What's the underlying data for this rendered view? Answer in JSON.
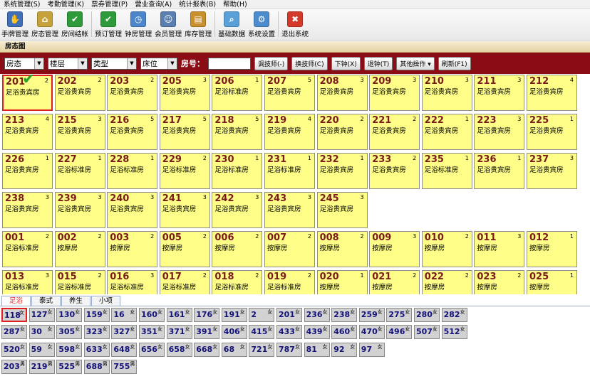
{
  "menubar": [
    "系统管理(S)",
    "考勤管理(K)",
    "票券管理(P)",
    "营业查询(A)",
    "统计报表(B)",
    "帮助(H)"
  ],
  "toolbar": [
    {
      "label": "手牌管理",
      "icon": "hand-card-icon",
      "color": "#3f6fb8"
    },
    {
      "label": "房态管理",
      "icon": "room-status-icon",
      "color": "#c6a23a"
    },
    {
      "label": "房间结帐",
      "icon": "checkout-check-icon",
      "color": "#2f9a3a"
    },
    {
      "label": "预订管理",
      "icon": "booking-check-icon",
      "color": "#2f9a3a"
    },
    {
      "label": "钟房管理",
      "icon": "clock-room-icon",
      "color": "#4a86c9"
    },
    {
      "label": "会员管理",
      "icon": "member-icon",
      "color": "#5a7fb0"
    },
    {
      "label": "库存管理",
      "icon": "inventory-icon",
      "color": "#c8902c"
    },
    {
      "label": "基础数据",
      "icon": "base-data-icon",
      "color": "#5aa0d8"
    },
    {
      "label": "系统设置",
      "icon": "system-settings-icon",
      "color": "#4c8ccc"
    },
    {
      "label": "退出系统",
      "icon": "exit-icon",
      "color": "#d43a2a"
    }
  ],
  "panel_title": "房态图",
  "filters": {
    "selects": [
      "房态",
      "楼层",
      "类型",
      "床位"
    ],
    "room_no_label": "房号：",
    "room_no_value": "",
    "buttons": [
      "调技师(-)",
      "换技师(C)",
      "下钟(X)",
      "退钟(T)",
      "其他操作 ▾",
      "刷新(F1)"
    ]
  },
  "rooms": [
    [
      {
        "no": "201",
        "type": "足浴贵宾房",
        "count": "2",
        "selected": true,
        "checked": true
      },
      {
        "no": "202",
        "type": "足浴贵宾房",
        "count": "2"
      },
      {
        "no": "203",
        "type": "足浴贵宾房",
        "count": "2"
      },
      {
        "no": "205",
        "type": "足浴贵宾房",
        "count": "3"
      },
      {
        "no": "206",
        "type": "足浴标准房",
        "count": "1"
      },
      {
        "no": "207",
        "type": "足浴贵宾房",
        "count": "5"
      },
      {
        "no": "208",
        "type": "足浴贵宾房",
        "count": "3"
      },
      {
        "no": "209",
        "type": "足浴贵宾房",
        "count": "3"
      },
      {
        "no": "210",
        "type": "足浴贵宾房",
        "count": "3"
      },
      {
        "no": "211",
        "type": "足浴贵宾房",
        "count": "3"
      },
      {
        "no": "212",
        "type": "足浴贵宾房",
        "count": "4"
      }
    ],
    [
      {
        "no": "213",
        "type": "足浴贵宾房",
        "count": "4"
      },
      {
        "no": "215",
        "type": "足浴贵宾房",
        "count": "3"
      },
      {
        "no": "216",
        "type": "足浴贵宾房",
        "count": "5"
      },
      {
        "no": "217",
        "type": "足浴贵宾房",
        "count": "5"
      },
      {
        "no": "218",
        "type": "足浴贵宾房",
        "count": "5"
      },
      {
        "no": "219",
        "type": "足浴贵宾房",
        "count": "4"
      },
      {
        "no": "220",
        "type": "足浴贵宾房",
        "count": "2"
      },
      {
        "no": "221",
        "type": "足浴贵宾房",
        "count": "2"
      },
      {
        "no": "222",
        "type": "足浴贵宾房",
        "count": "1"
      },
      {
        "no": "223",
        "type": "足浴贵宾房",
        "count": "3"
      },
      {
        "no": "225",
        "type": "足浴贵宾房",
        "count": "1"
      }
    ],
    [
      {
        "no": "226",
        "type": "足浴贵宾房",
        "count": "1"
      },
      {
        "no": "227",
        "type": "足浴标准房",
        "count": "1"
      },
      {
        "no": "228",
        "type": "足浴标准房",
        "count": "1"
      },
      {
        "no": "229",
        "type": "足浴标准房",
        "count": "2"
      },
      {
        "no": "230",
        "type": "足浴标准房",
        "count": "1"
      },
      {
        "no": "231",
        "type": "足浴标准房",
        "count": "1"
      },
      {
        "no": "232",
        "type": "足浴贵宾房",
        "count": "1"
      },
      {
        "no": "233",
        "type": "足浴贵宾房",
        "count": "2"
      },
      {
        "no": "235",
        "type": "足浴标准房",
        "count": "1"
      },
      {
        "no": "236",
        "type": "足浴贵宾房",
        "count": "1"
      },
      {
        "no": "237",
        "type": "足浴贵宾房",
        "count": "3"
      }
    ],
    [
      {
        "no": "238",
        "type": "足浴贵宾房",
        "count": "3"
      },
      {
        "no": "239",
        "type": "足浴贵宾房",
        "count": "3"
      },
      {
        "no": "240",
        "type": "足浴贵宾房",
        "count": "3"
      },
      {
        "no": "241",
        "type": "足浴贵宾房",
        "count": "3"
      },
      {
        "no": "242",
        "type": "足浴贵宾房",
        "count": "3"
      },
      {
        "no": "243",
        "type": "足浴贵宾房",
        "count": "3"
      },
      {
        "no": "245",
        "type": "足浴贵宾房",
        "count": "3"
      }
    ],
    [
      {
        "no": "001",
        "type": "足浴标准房",
        "count": "2"
      },
      {
        "no": "002",
        "type": "按摩房",
        "count": "2"
      },
      {
        "no": "003",
        "type": "按摩房",
        "count": "2"
      },
      {
        "no": "005",
        "type": "按摩房",
        "count": "2"
      },
      {
        "no": "006",
        "type": "按摩房",
        "count": "2"
      },
      {
        "no": "007",
        "type": "按摩房",
        "count": "2"
      },
      {
        "no": "008",
        "type": "按摩房",
        "count": "2"
      },
      {
        "no": "009",
        "type": "按摩房",
        "count": "3"
      },
      {
        "no": "010",
        "type": "按摩房",
        "count": "2"
      },
      {
        "no": "011",
        "type": "按摩房",
        "count": "3"
      },
      {
        "no": "012",
        "type": "按摩房",
        "count": "1"
      }
    ],
    [
      {
        "no": "013",
        "type": "足浴标准房",
        "count": "3"
      },
      {
        "no": "015",
        "type": "足浴标准房",
        "count": "2"
      },
      {
        "no": "016",
        "type": "足浴标准房",
        "count": "3"
      },
      {
        "no": "017",
        "type": "足浴标准房",
        "count": "2"
      },
      {
        "no": "018",
        "type": "足浴标准房",
        "count": "2"
      },
      {
        "no": "019",
        "type": "足浴标准房",
        "count": "2"
      },
      {
        "no": "020",
        "type": "按摩房",
        "count": "1"
      },
      {
        "no": "021",
        "type": "按摩房",
        "count": "2"
      },
      {
        "no": "022",
        "type": "按摩房",
        "count": "2"
      },
      {
        "no": "023",
        "type": "按摩房",
        "count": "2"
      },
      {
        "no": "025",
        "type": "按摩房",
        "count": "1"
      }
    ]
  ],
  "tabs": [
    "足浴",
    "泰式",
    "养生",
    "小项"
  ],
  "active_tab": 0,
  "technicians": [
    [
      {
        "no": "118",
        "g": "女",
        "selected": true
      },
      {
        "no": "127",
        "g": "女"
      },
      {
        "no": "130",
        "g": "女"
      },
      {
        "no": "159",
        "g": "女"
      },
      {
        "no": "16",
        "g": "女"
      },
      {
        "no": "160",
        "g": "女"
      },
      {
        "no": "161",
        "g": "女"
      },
      {
        "no": "176",
        "g": "女"
      },
      {
        "no": "191",
        "g": "女"
      },
      {
        "no": "2",
        "g": "女"
      },
      {
        "no": "201",
        "g": "女"
      },
      {
        "no": "236",
        "g": "女"
      },
      {
        "no": "238",
        "g": "女"
      },
      {
        "no": "259",
        "g": "女"
      },
      {
        "no": "275",
        "g": "女"
      },
      {
        "no": "280",
        "g": "女"
      },
      {
        "no": "282",
        "g": "女"
      }
    ],
    [
      {
        "no": "287",
        "g": "女"
      },
      {
        "no": "30",
        "g": "女"
      },
      {
        "no": "305",
        "g": "女"
      },
      {
        "no": "323",
        "g": "女"
      },
      {
        "no": "327",
        "g": "女"
      },
      {
        "no": "351",
        "g": "女"
      },
      {
        "no": "371",
        "g": "女"
      },
      {
        "no": "391",
        "g": "女"
      },
      {
        "no": "406",
        "g": "女"
      },
      {
        "no": "415",
        "g": "女"
      },
      {
        "no": "433",
        "g": "女"
      },
      {
        "no": "439",
        "g": "女"
      },
      {
        "no": "460",
        "g": "女"
      },
      {
        "no": "470",
        "g": "女"
      },
      {
        "no": "496",
        "g": "女"
      },
      {
        "no": "507",
        "g": "女"
      },
      {
        "no": "512",
        "g": "女"
      }
    ],
    [
      {
        "no": "520",
        "g": "女"
      },
      {
        "no": "59",
        "g": "女"
      },
      {
        "no": "598",
        "g": "女"
      },
      {
        "no": "633",
        "g": "女"
      },
      {
        "no": "648",
        "g": "女"
      },
      {
        "no": "656",
        "g": "女"
      },
      {
        "no": "658",
        "g": "女"
      },
      {
        "no": "668",
        "g": "女"
      },
      {
        "no": "68",
        "g": "女"
      },
      {
        "no": "721",
        "g": "女"
      },
      {
        "no": "787",
        "g": "女"
      },
      {
        "no": "81",
        "g": "女"
      },
      {
        "no": "92",
        "g": "女"
      },
      {
        "no": "97",
        "g": "女"
      }
    ],
    [
      {
        "no": "203",
        "g": "男"
      },
      {
        "no": "219",
        "g": "男"
      },
      {
        "no": "525",
        "g": "男"
      },
      {
        "no": "688",
        "g": "男"
      },
      {
        "no": "755",
        "g": "男"
      }
    ]
  ]
}
